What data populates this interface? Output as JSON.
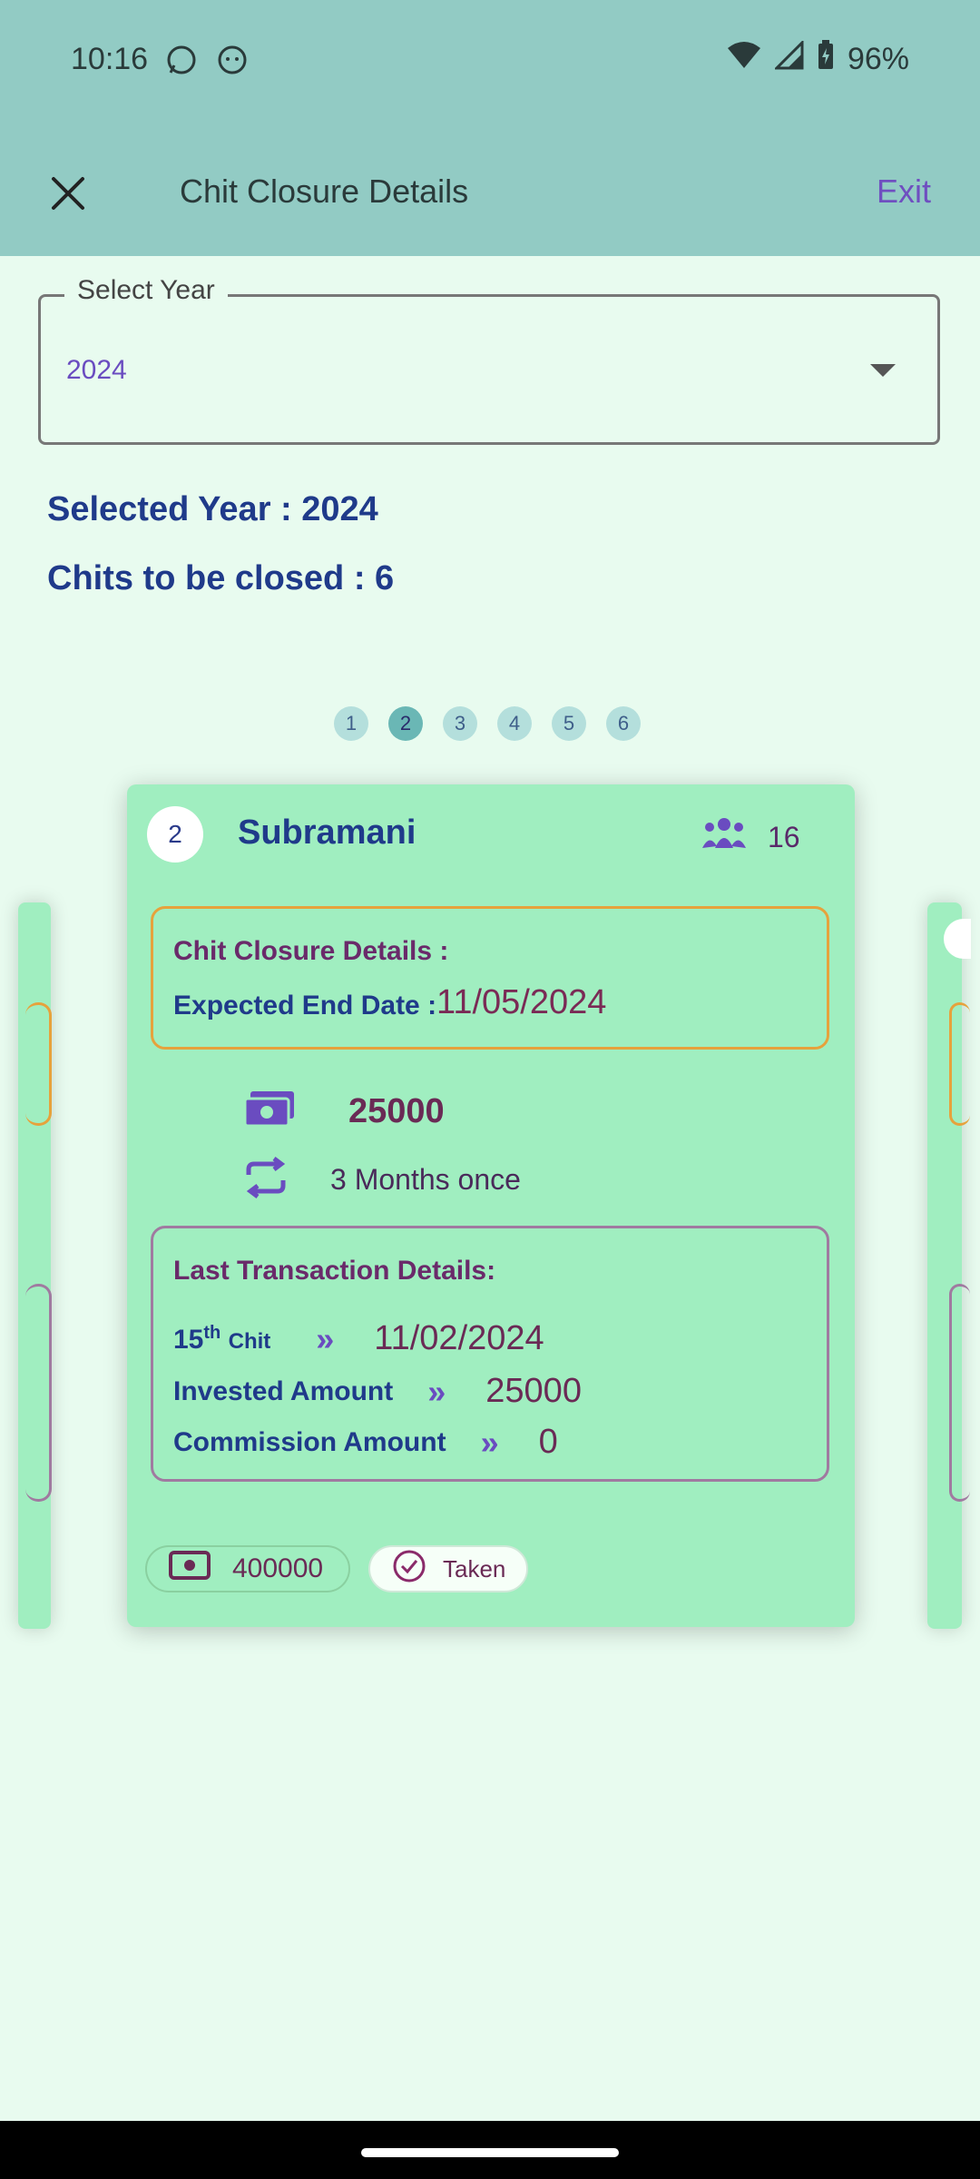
{
  "status_bar": {
    "time": "10:16",
    "battery": "96%"
  },
  "app_bar": {
    "title": "Chit Closure Details",
    "exit_label": "Exit"
  },
  "year_select": {
    "label": "Select Year",
    "value": "2024"
  },
  "summary": {
    "selected_year": "Selected Year : 2024",
    "chits_to_close": "Chits to be closed : 6"
  },
  "pager": {
    "pages": [
      "1",
      "2",
      "3",
      "4",
      "5",
      "6"
    ],
    "active_index": 1
  },
  "card": {
    "number": "2",
    "name": "Subramani",
    "members": "16",
    "closure_title": "Chit Closure Details :",
    "expected_end_label": "Expected End Date :",
    "expected_end_date": "11/05/2024",
    "amount": "25000",
    "frequency": "3 Months once",
    "last_title": "Last Transaction Details:",
    "chit_label_num": "15",
    "chit_label_sup": "th",
    "chit_label_word": "Chit",
    "chit_date": "11/02/2024",
    "invested_label": "Invested Amount",
    "invested_value": "25000",
    "commission_label": "Commission Amount",
    "commission_value": "0",
    "total_amount": "400000",
    "status_label": "Taken"
  },
  "colors": {
    "app_bar": "#92cbc4",
    "background": "#e8fbef",
    "card": "#a0eec0",
    "accent": "#6a4cc0",
    "heading": "#1f3a8a"
  }
}
